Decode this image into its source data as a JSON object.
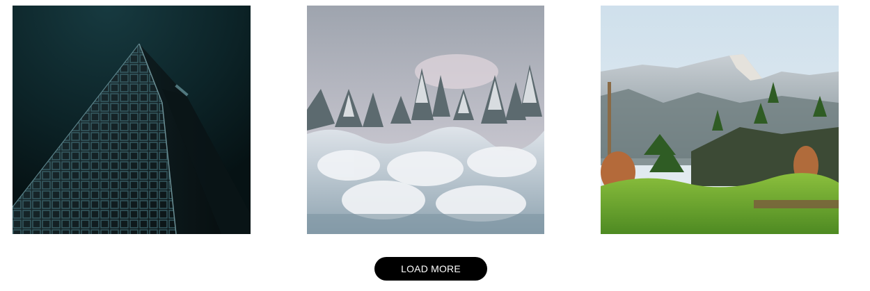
{
  "gallery": {
    "images": [
      {
        "alt": "",
        "subject": "skyscraper-at-night"
      },
      {
        "alt": "",
        "subject": "snowy-pine-forest"
      },
      {
        "alt": "",
        "subject": "mountain-valley-with-pines"
      }
    ],
    "load_more_label": "LOAD MORE"
  },
  "colors": {
    "button_bg": "#000000",
    "button_text": "#ffffff"
  }
}
